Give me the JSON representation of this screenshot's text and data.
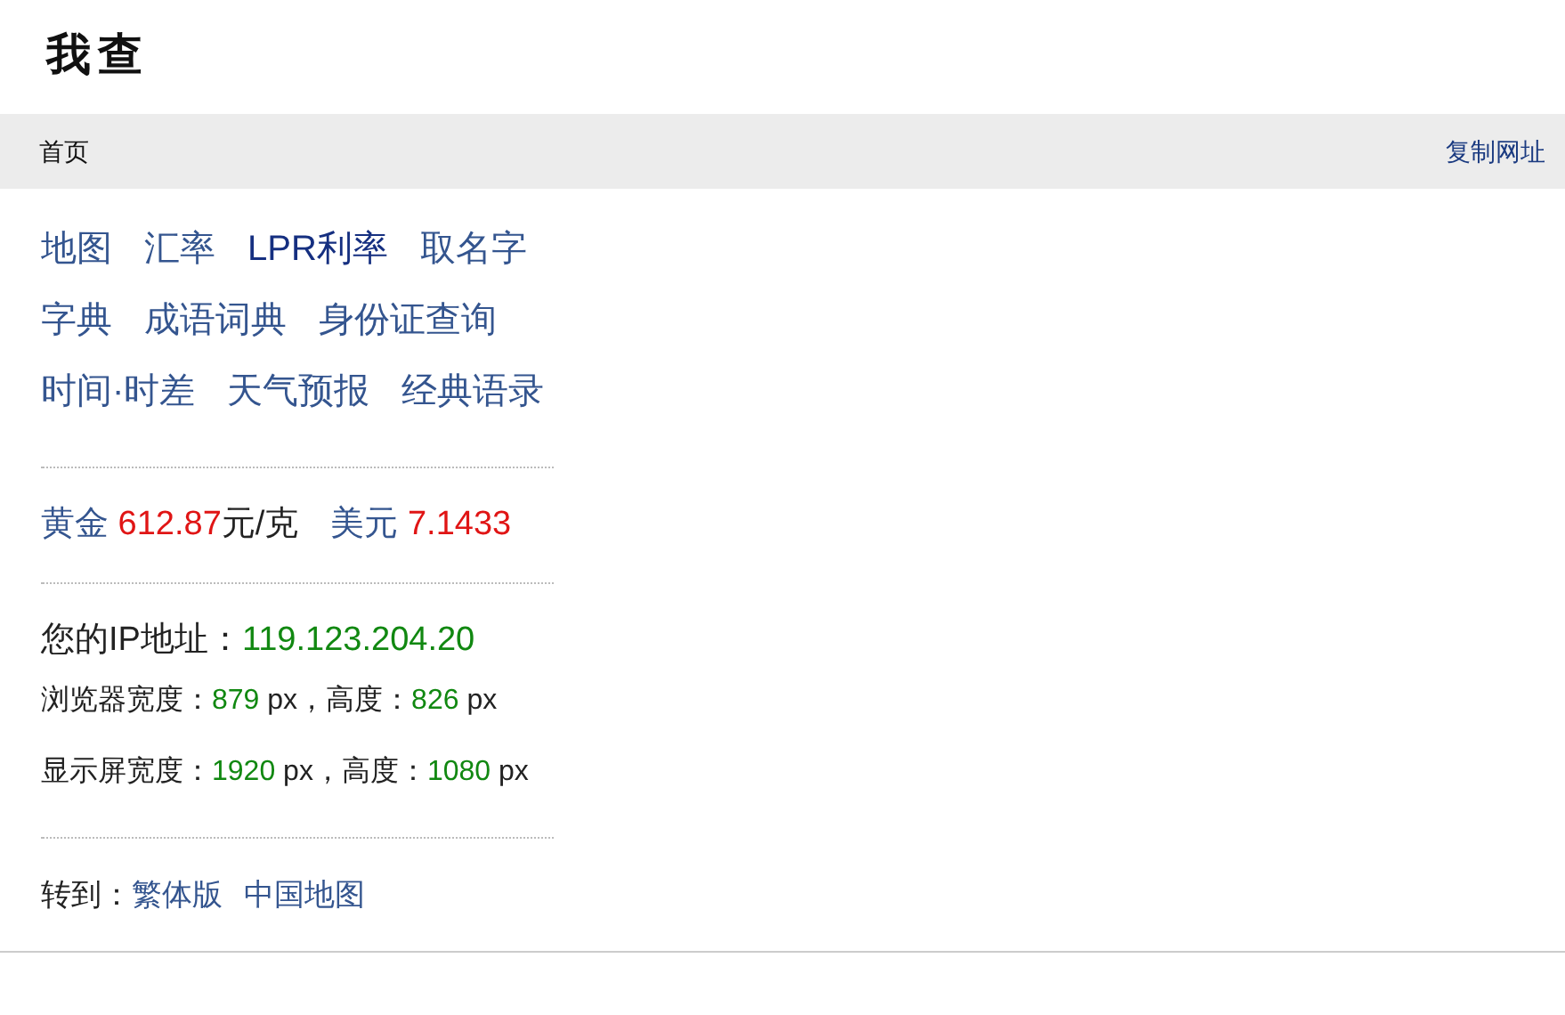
{
  "logo": "我查",
  "breadcrumb": {
    "home": "首页",
    "action": "复制网址"
  },
  "link_rows": [
    [
      {
        "label": "地图",
        "visited": false
      },
      {
        "label": "汇率",
        "visited": false
      },
      {
        "label": "LPR利率",
        "visited": true
      },
      {
        "label": "取名字",
        "visited": false
      }
    ],
    [
      {
        "label": "字典",
        "visited": false
      },
      {
        "label": "成语词典",
        "visited": false
      },
      {
        "label": "身份证查询",
        "visited": false
      }
    ],
    [
      {
        "label": "时间·时差",
        "visited": false
      },
      {
        "label": "天气预报",
        "visited": false
      },
      {
        "label": "经典语录",
        "visited": false
      }
    ]
  ],
  "prices": [
    {
      "label": "黄金",
      "value": "612.87",
      "unit": "元/克"
    },
    {
      "label": "美元",
      "value": "7.1433"
    }
  ],
  "info_lines": [
    [
      {
        "kind": "text",
        "text": "您的IP地址："
      },
      {
        "kind": "value",
        "text": "119.123.204.20"
      }
    ],
    [
      {
        "kind": "text",
        "text": "浏览器宽度："
      },
      {
        "kind": "value",
        "text": "879"
      },
      {
        "kind": "text",
        "text": " px，高度："
      },
      {
        "kind": "value",
        "text": "826"
      },
      {
        "kind": "text",
        "text": " px"
      }
    ],
    [
      {
        "kind": "text",
        "text": "显示屏宽度："
      },
      {
        "kind": "value",
        "text": "1920"
      },
      {
        "kind": "text",
        "text": " px，高度："
      },
      {
        "kind": "value",
        "text": "1080"
      },
      {
        "kind": "text",
        "text": " px"
      }
    ]
  ],
  "goto": {
    "label": "转到：",
    "links": [
      "繁体版",
      "中国地图"
    ]
  }
}
